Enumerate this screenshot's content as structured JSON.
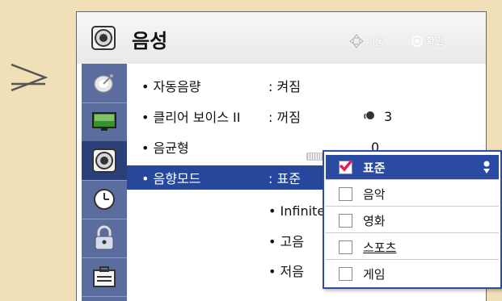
{
  "header": {
    "title": "음성",
    "hint_move": "이동",
    "hint_ok": "확인",
    "icon": "speaker-icon",
    "move_icon": "dpad-icon",
    "ok_icon": "ok-button-icon"
  },
  "sidebar": {
    "items": [
      {
        "icon": "satellite-dish-icon",
        "active": false
      },
      {
        "icon": "tv-screen-icon",
        "active": false
      },
      {
        "icon": "speaker-icon",
        "active": true
      },
      {
        "icon": "clock-icon",
        "active": false
      },
      {
        "icon": "lock-icon",
        "active": false
      },
      {
        "icon": "toolbox-icon",
        "active": false
      }
    ]
  },
  "menu": {
    "items": [
      {
        "label": "• 자동음량",
        "value": ": 켜짐"
      },
      {
        "label": "• 클리어 보이스 II",
        "value": ": 꺼짐",
        "level": "3",
        "level_icon": "voice-icon"
      },
      {
        "label": "• 음균형",
        "value": "0"
      },
      {
        "label": "• 음향모드",
        "value": ": 표준"
      },
      {
        "label": "",
        "value": "• Infinite"
      },
      {
        "label": "",
        "value": "• 고음"
      },
      {
        "label": "",
        "value": "• 저음"
      }
    ]
  },
  "dropdown": {
    "options": [
      {
        "label": "표준",
        "checked": true
      },
      {
        "label": "음악",
        "checked": false
      },
      {
        "label": "영화",
        "checked": false
      },
      {
        "label": "스포츠",
        "checked": false
      },
      {
        "label": "게임",
        "checked": false
      }
    ],
    "scroll_icon": "scroll-arrows-icon"
  },
  "colors": {
    "background": "#f1dfb8",
    "sidebar": "#5a6d9d",
    "selected": "#27479c",
    "checkmark": "#e0205a"
  }
}
